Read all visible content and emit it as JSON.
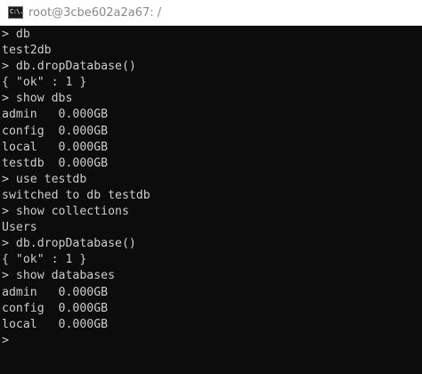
{
  "window": {
    "icon_label": "C:\\.",
    "title": "root@3cbe602a2a67: /"
  },
  "console": {
    "lines": [
      "> db",
      "test2db",
      "> db.dropDatabase()",
      "{ \"ok\" : 1 }",
      "> show dbs",
      "admin   0.000GB",
      "config  0.000GB",
      "local   0.000GB",
      "testdb  0.000GB",
      "> use testdb",
      "switched to db testdb",
      "> show collections",
      "Users",
      "> db.dropDatabase()",
      "{ \"ok\" : 1 }",
      "> show databases",
      "admin   0.000GB",
      "config  0.000GB",
      "local   0.000GB",
      ">"
    ]
  }
}
